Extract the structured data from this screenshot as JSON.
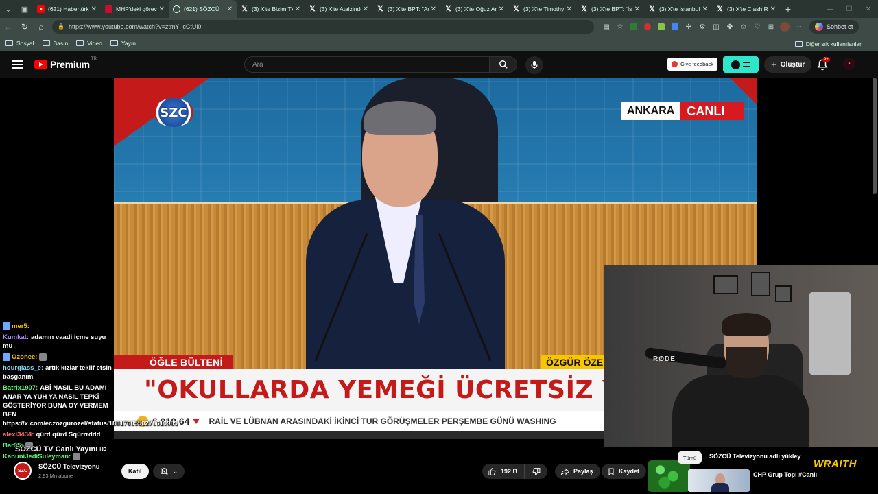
{
  "browser": {
    "tabs": [
      {
        "label": "(621) Habertürk",
        "icon": "youtube-icon"
      },
      {
        "label": "MHP'deki görevi",
        "icon": "tv-icon"
      },
      {
        "label": "(621) SÖZCÜ",
        "icon": "youtube-icon",
        "active": true
      },
      {
        "label": "(3) X'te Bizim TV",
        "icon": "x-icon"
      },
      {
        "label": "(3) X'te Ataizinde",
        "icon": "x-icon"
      },
      {
        "label": "(3) X'te BPT: \"Adı",
        "icon": "x-icon"
      },
      {
        "label": "(3) X'te Oğuz An",
        "icon": "x-icon"
      },
      {
        "label": "(3) X'te Timothy",
        "icon": "x-icon"
      },
      {
        "label": "(3) X'te BPT: \"İsp",
        "icon": "x-icon"
      },
      {
        "label": "(3) X'te İstanbul S",
        "icon": "x-icon"
      },
      {
        "label": "(3) X'te Clash Re",
        "icon": "x-icon"
      }
    ],
    "url": "https://www.youtube.com/watch?v=ztmY_cCtUl0",
    "copilot_label": "Sohbet et",
    "bookmarks": [
      "Sosyal",
      "Basın",
      "Video",
      "Yayın"
    ],
    "bookmarks_other": "Diğer sık kullanılanlar"
  },
  "youtube": {
    "logo_text": "Premium",
    "logo_region": "TR",
    "search_placeholder": "Ara",
    "feedback_label": "Give feedback",
    "create_label": "Oluştur",
    "notif_count": "9+"
  },
  "video": {
    "channel_bug": "SZC",
    "location_city": "ANKARA",
    "location_live": "CANLI",
    "program_label": "ÖĞLE BÜLTENİ",
    "speaker_name": "ÖZGÜR ÖZE",
    "headline": "\"OKULLARDA YEMEĞİ ÜCRETSİZ YA",
    "ticker_value": "6.910,64",
    "ticker_news": "RAİL VE LÜBNAN ARASINDAKİ İKİNCİ TUR GÖRÜŞMELER PERŞEMBE GÜNÜ WASHING"
  },
  "webcam": {
    "mic_brand": "RØDE"
  },
  "chat": [
    {
      "user": "mer5:",
      "color": "gold",
      "text": "",
      "emote_before": true
    },
    {
      "user": "Kumkat:",
      "color": "purple",
      "text": "adamın vaadi içme suyu mu"
    },
    {
      "user": "Ozonee:",
      "color": "gold",
      "text": "",
      "emote_before": true,
      "emote_after": true
    },
    {
      "user": "hourglass_e:",
      "color": "cyan",
      "text": "artık kızlar teklif etsin başganım"
    },
    {
      "user": "Batrix1907:",
      "color": "green",
      "text": "ABİ NASIL BU ADAMI ANAR YA YUH YA NASIL TEPKİ GÖSTERİYOR BUNA OY VERMEM BEN https://x.com/eczozgurozel/status/1881768550278610989"
    },
    {
      "user": "alexi3434:",
      "color": "red",
      "text": "qürd qürd Sqürrrddd"
    },
    {
      "user": "Bar95:",
      "color": "green",
      "text": "",
      "emote_after": true
    },
    {
      "user": "KanuniJediSuleyman:",
      "color": "green",
      "text": "",
      "emote_after": true
    }
  ],
  "info": {
    "title": "SÖZCÜ TV Canlı Yayını",
    "quality": "HD",
    "channel_name": "SÖZCÜ Televizyonu",
    "subscribers": "2,93 Mn abone",
    "join_label": "Katıl",
    "likes": "192 B",
    "share_label": "Paylaş",
    "save_label": "Kaydet"
  },
  "related": {
    "chip_all": "Tümü",
    "chip_channel": "SÖZCÜ Televizyonu adlı yükley",
    "item_title": "CHP Grup Topl #Canlı",
    "overlay_brand": "WRAITH"
  },
  "colors": {
    "youtube_red": "#ff0000",
    "accent_teal": "#2ee6c9",
    "chrome_bg": "#2a3431"
  }
}
